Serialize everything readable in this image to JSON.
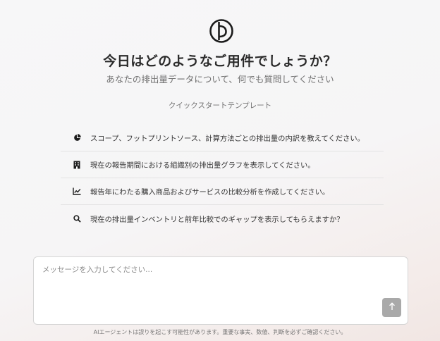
{
  "hero": {
    "logo_icon": "brand-logo-icon",
    "title": "今日はどのようなご用件でしょうか？",
    "subtitle": "あなたの排出量データについて、何でも質問してください"
  },
  "quick_start": {
    "label": "クイックスタートテンプレート",
    "items": [
      {
        "icon": "pie-chart-icon",
        "label": "スコープ、フットプリントソース、計算方法ごとの排出量の内訳を教えてください。"
      },
      {
        "icon": "building-icon",
        "label": "現在の報告期間における組織別の排出量グラフを表示してください。"
      },
      {
        "icon": "line-chart-icon",
        "label": "報告年にわたる購入商品およびサービスの比較分析を作成してください。"
      },
      {
        "icon": "search-icon",
        "label": "現在の排出量インベントリと前年比較でのギャップを表示してもらえますか？"
      }
    ]
  },
  "composer": {
    "placeholder": "メッセージを入力してください...",
    "value": "",
    "send_icon": "arrow-up-icon"
  },
  "footer": {
    "disclaimer": "AIエージェントは誤りを起こす可能性があります。重要な事実、数値、判断を必ずご確認ください。"
  },
  "colors": {
    "text_primary": "#2b2b2b",
    "text_secondary": "#707070",
    "send_button": "#a9a9a9",
    "divider": "#e3e3e3"
  }
}
